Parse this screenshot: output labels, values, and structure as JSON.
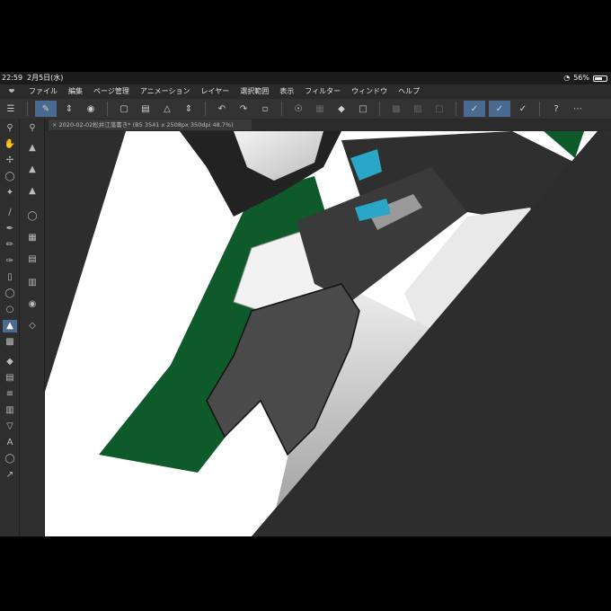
{
  "status": {
    "time": "22:59",
    "date": "2月5日(水)",
    "battery": "56%"
  },
  "menu": {
    "items": [
      "ファイル",
      "編集",
      "ページ管理",
      "アニメーション",
      "レイヤー",
      "選択範囲",
      "表示",
      "フィルター",
      "ウィンドウ",
      "ヘルプ"
    ]
  },
  "document": {
    "tab_label": "2020-02-02松井江落書き* (B5 3541 x 2508px 350dpi 48.7%)"
  },
  "colors": {
    "accent": "#4a6a92",
    "coat_green": "#0f5a2b",
    "tie_blue": "#2aa6c6",
    "canvas_bg": "#2d2d2d"
  },
  "icons": {
    "tools": [
      "zoom-icon",
      "hand-icon",
      "move-icon",
      "lasso-icon",
      "magic-wand-icon",
      "eyedropper-icon",
      "pen-icon",
      "pencil-icon",
      "brush-icon",
      "eraser-icon",
      "decoration-icon",
      "blend-icon",
      "fill-icon",
      "gradient-icon",
      "figure-icon",
      "frame-icon",
      "ruler-icon",
      "text-icon",
      "balloon-icon",
      "correction-icon"
    ],
    "subtools": [
      "fill-bucket-icon",
      "fill-drop-icon",
      "fill-enclose-icon",
      "layer-icon",
      "material-icon",
      "navigator-icon",
      "info-icon",
      "layer-property-icon",
      "stack-icon"
    ]
  }
}
